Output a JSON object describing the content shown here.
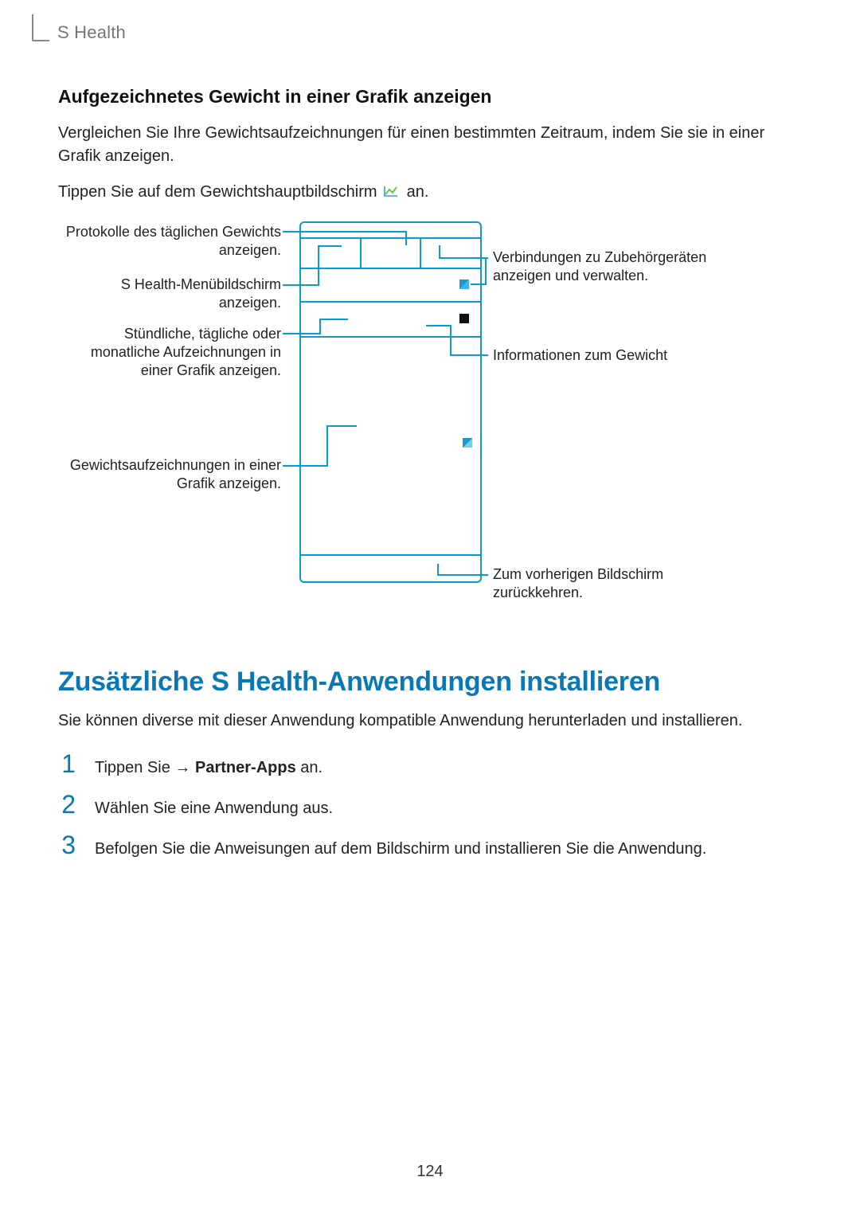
{
  "header": {
    "title": "S Health"
  },
  "section1": {
    "heading": "Aufgezeichnetes Gewicht in einer Grafik anzeigen",
    "para1": "Vergleichen Sie Ihre Gewichtsaufzeichnungen für einen bestimmten Zeitraum, indem Sie sie in einer Grafik anzeigen.",
    "para2_pre": "Tippen Sie auf dem Gewichtshauptbildschirm ",
    "para2_post": " an."
  },
  "callouts": {
    "left": [
      "Protokolle des täglichen Gewichts anzeigen.",
      "S Health-Menübildschirm anzeigen.",
      "Stündliche, tägliche oder monatliche Aufzeichnungen in einer Grafik anzeigen.",
      "Gewichtsaufzeichnungen in einer Grafik anzeigen."
    ],
    "right": [
      "Verbindungen zu Zubehörgeräten anzeigen und verwalten.",
      "Informationen zum Gewicht",
      "Zum vorherigen Bildschirm zurückkehren."
    ]
  },
  "section2": {
    "title": "Zusätzliche S Health-Anwendungen installieren",
    "para": "Sie können diverse mit dieser Anwendung kompatible Anwendung herunterladen und installieren.",
    "steps": [
      {
        "num": "1",
        "pre": "Tippen Sie      → ",
        "bold": "Partner-Apps",
        "post": " an."
      },
      {
        "num": "2",
        "text": "Wählen Sie eine Anwendung aus."
      },
      {
        "num": "3",
        "text": "Befolgen Sie die Anweisungen auf dem Bildschirm und installieren Sie die Anwendung."
      }
    ]
  },
  "page_number": "124"
}
